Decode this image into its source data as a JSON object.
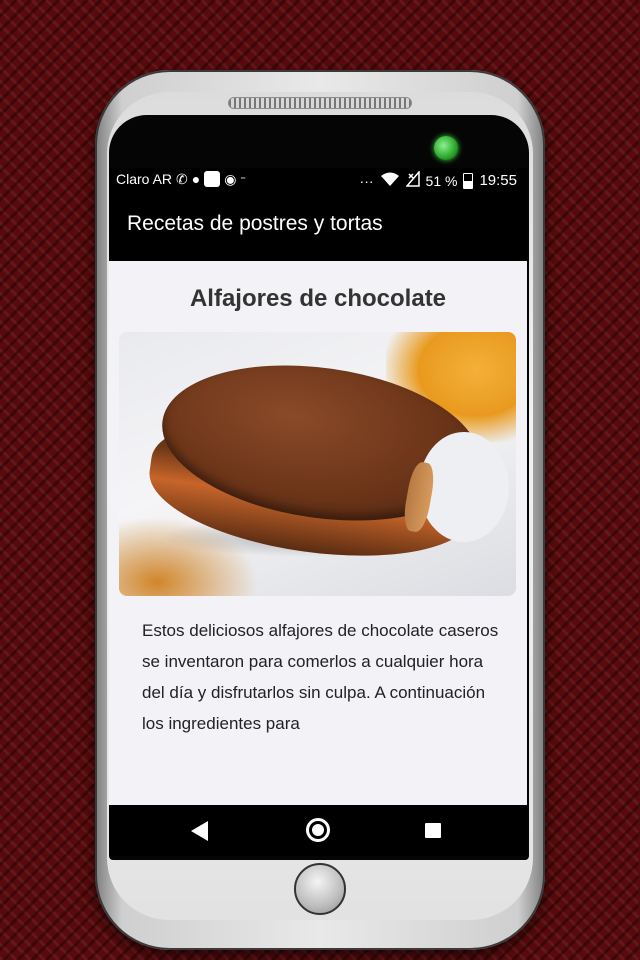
{
  "status_bar": {
    "carrier": "Claro AR",
    "icons": [
      "whatsapp-icon",
      "chat-bubble-icon",
      "square-app-icon",
      "navigation-icon",
      "grid-app-icon",
      "more-dots-icon",
      "wifi-icon",
      "no-signal-icon"
    ],
    "more": "···",
    "battery_percent": "51 %",
    "time": "19:55"
  },
  "app_bar": {
    "title": "Recetas de postres y tortas"
  },
  "recipe": {
    "title": "Alfajores de chocolate",
    "image_subject": "chocolate-alfajor-photo",
    "description": "Estos deliciosos alfajores de chocolate caseros se inventaron para comerlos a cualquier hora del día y disfrutarlos sin culpa. A continuación los ingredientes para"
  },
  "nav_bar": {
    "items": [
      "back-icon",
      "home-icon",
      "recents-icon"
    ]
  },
  "colors": {
    "background": "#5a0a0c",
    "app_bar": "#000000",
    "content": "#f3f3f7"
  }
}
